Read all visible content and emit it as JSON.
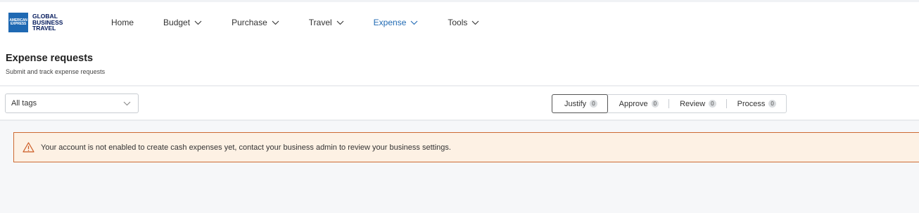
{
  "logo": {
    "mark_text": "AMERICAN EXPRESS",
    "brand_lines": [
      "GLOBAL",
      "BUSINESS",
      "TRAVEL"
    ],
    "brand_color": "#1f69b3"
  },
  "nav": {
    "items": [
      {
        "label": "Home",
        "has_menu": false
      },
      {
        "label": "Budget",
        "has_menu": true
      },
      {
        "label": "Purchase",
        "has_menu": true
      },
      {
        "label": "Travel",
        "has_menu": true
      },
      {
        "label": "Expense",
        "has_menu": true,
        "active": true
      },
      {
        "label": "Tools",
        "has_menu": true
      }
    ],
    "active_color": "#1f69b3"
  },
  "page": {
    "title": "Expense requests",
    "subtitle": "Submit and track expense requests"
  },
  "filters": {
    "tags_select": {
      "value": "All tags",
      "icon": "chevron-down-icon"
    },
    "tabs": [
      {
        "label": "Justify",
        "count": "0",
        "active": true
      },
      {
        "label": "Approve",
        "count": "0"
      },
      {
        "label": "Review",
        "count": "0"
      },
      {
        "label": "Process",
        "count": "0"
      }
    ]
  },
  "alert": {
    "icon": "warning-icon",
    "text": "Your account is not enabled to create cash expenses yet, contact your business admin to review your business settings.",
    "border_color": "#cc6a33",
    "background": "#fdf1e4"
  }
}
